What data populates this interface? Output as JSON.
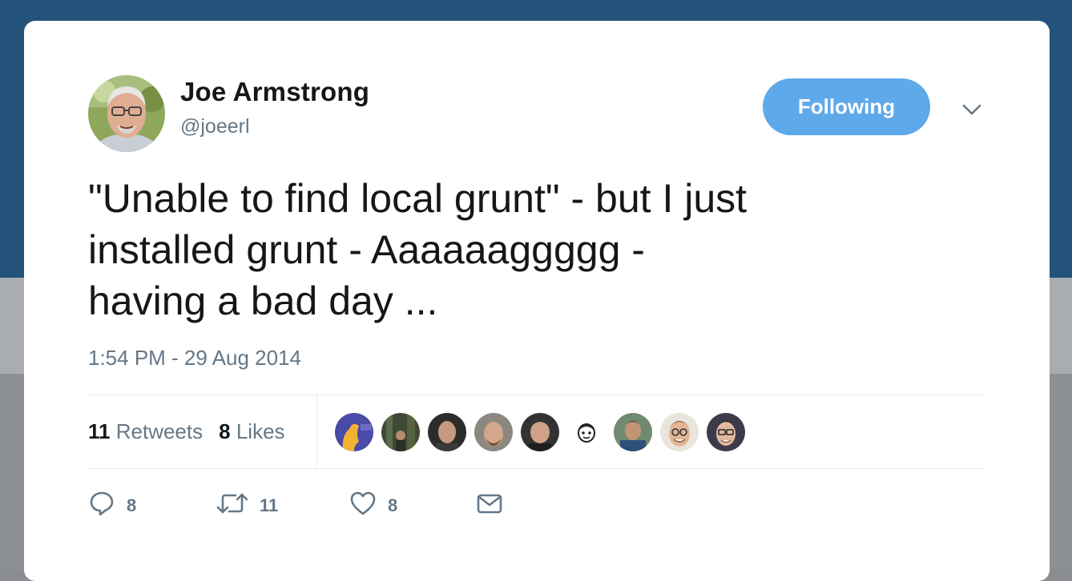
{
  "user": {
    "name": "Joe Armstrong",
    "handle": "@joeerl"
  },
  "follow_button": {
    "label": "Following"
  },
  "tweet": {
    "lines": [
      "\"Unable to find local grunt\" - but I just",
      "installed grunt - Aaaaaaggggg -",
      "having a bad day ..."
    ],
    "timestamp": "1:54 PM - 29 Aug 2014"
  },
  "stats": {
    "retweets_count": "11",
    "retweets_label": "Retweets",
    "likes_count": "8",
    "likes_label": "Likes"
  },
  "actions": {
    "reply_count": "8",
    "retweet_count": "11",
    "like_count": "8"
  },
  "colors": {
    "accent": "#5ea9ea",
    "header_bg": "#23537b",
    "text": "#14171a",
    "secondary": "#657786"
  },
  "icons": [
    "chevron-down-icon",
    "reply-icon",
    "retweet-icon",
    "heart-icon",
    "message-icon"
  ]
}
